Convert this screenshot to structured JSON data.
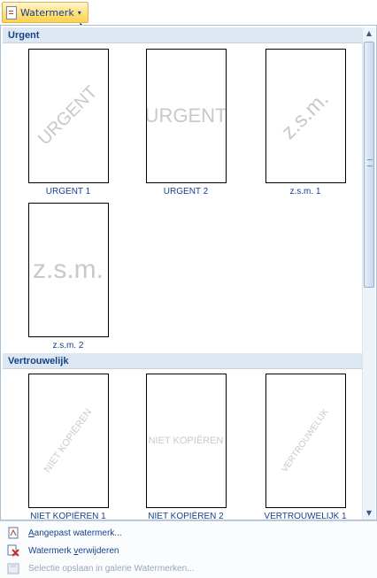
{
  "button": {
    "label": "Watermerk",
    "caret": "▾"
  },
  "sections": [
    {
      "title": "Urgent"
    },
    {
      "title": "Vertrouwelijk"
    }
  ],
  "thumbnails": [
    {
      "caption": "URGENT 1",
      "text": "URGENT",
      "style": "diagonal"
    },
    {
      "caption": "URGENT 2",
      "text": "URGENT",
      "style": "horizontal"
    },
    {
      "caption": "z.s.m. 1",
      "text": "z.s.m.",
      "style": "diagonal"
    },
    {
      "caption": "z.s.m. 2",
      "text": "z.s.m.",
      "style": "horizontal"
    },
    {
      "caption": "NIET KOPIËREN 1",
      "text": "NIET KOPIËREN",
      "style": "diagonal"
    },
    {
      "caption": "NIET KOPIËREN 2",
      "text": "NIET KOPIËREN",
      "style": "horizontal"
    },
    {
      "caption": "VERTROUWELIJK 1",
      "text": "VERTROUWELIJK",
      "style": "diagonal"
    }
  ],
  "menu": {
    "custom": {
      "prefix": "",
      "accel": "A",
      "rest": "angepast watermerk..."
    },
    "remove": {
      "prefix": "Watermerk ",
      "accel": "v",
      "rest": "erwijderen"
    },
    "save": {
      "label": "Selectie opslaan in galerie Watermerken..."
    }
  },
  "colors": {
    "accent": "#15428b",
    "header": "#dde7f2",
    "watermark": "#c9c9c9"
  },
  "icons": [
    "watermark-doc-icon",
    "chevron-down-icon",
    "scroll-up-icon",
    "scroll-down-icon",
    "custom-watermark-icon",
    "remove-watermark-icon",
    "save-selection-icon"
  ]
}
